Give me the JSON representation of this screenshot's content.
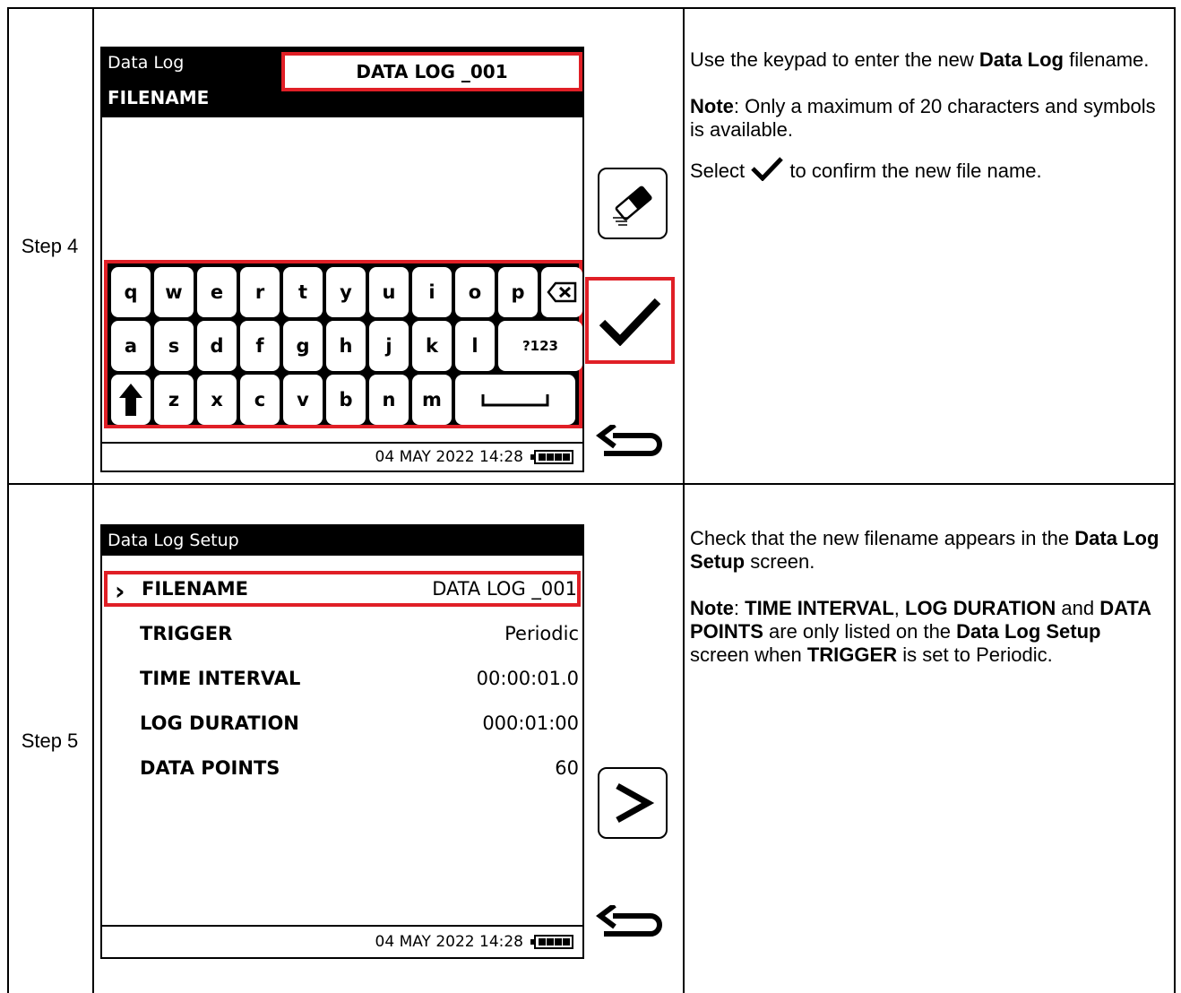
{
  "step4": {
    "label": "Step 4",
    "screen": {
      "title": "Data Log",
      "field_label": "FILENAME",
      "field_value": "DATA LOG _001",
      "keys_row1": [
        "q",
        "w",
        "e",
        "r",
        "t",
        "y",
        "u",
        "i",
        "o",
        "p"
      ],
      "keys_row2": [
        "a",
        "s",
        "d",
        "f",
        "g",
        "h",
        "j",
        "k",
        "l"
      ],
      "key_numbers": "?123",
      "keys_row3": [
        "z",
        "x",
        "c",
        "v",
        "b",
        "n",
        "m"
      ],
      "status_datetime": "04 MAY 2022 14:28"
    },
    "icons": [
      "backspace-icon",
      "shift-arrow-icon",
      "space-bar-icon",
      "eraser-icon",
      "checkmark-icon",
      "back-arrow-icon",
      "battery-icon"
    ],
    "desc": {
      "p1_a": "Use the keypad to enter the new ",
      "p1_bold": "Data Log",
      "p1_b": " filename.",
      "note_label": "Note",
      "p2_text": ": Only a maximum of 20 characters and symbols is available.",
      "p3_a": "Select ",
      "p3_b": " to confirm the new file name."
    }
  },
  "step5": {
    "label": "Step 5",
    "screen": {
      "title": "Data Log Setup",
      "rows": [
        {
          "label": "FILENAME",
          "value": "DATA LOG _001"
        },
        {
          "label": "TRIGGER",
          "value": "Periodic"
        },
        {
          "label": "TIME INTERVAL",
          "value": "00:00:01.0"
        },
        {
          "label": "LOG DURATION",
          "value": "000:01:00"
        },
        {
          "label": "DATA POINTS",
          "value": "60"
        }
      ],
      "status_datetime": "04 MAY 2022 14:28"
    },
    "icons": [
      "chevron-right-icon",
      "next-button-icon",
      "back-arrow-icon",
      "battery-icon"
    ],
    "desc": {
      "p1_a": "Check that the new filename appears in the ",
      "p1_bold": "Data Log Setup",
      "p1_b": " screen.",
      "note_label": "Note",
      "p2_a": ": ",
      "p2_b1": "TIME INTERVAL",
      "p2_c": ", ",
      "p2_b2": "LOG DURATION",
      "p2_d": " and ",
      "p2_b3": "DATA POINTS",
      "p2_e": " are only listed on the ",
      "p2_b4": "Data Log Setup",
      "p2_f": " screen when ",
      "p2_b5": "TRIGGER",
      "p2_g": " is set to Periodic."
    }
  },
  "colors": {
    "highlight": "#e01f26",
    "ink": "#000000"
  }
}
